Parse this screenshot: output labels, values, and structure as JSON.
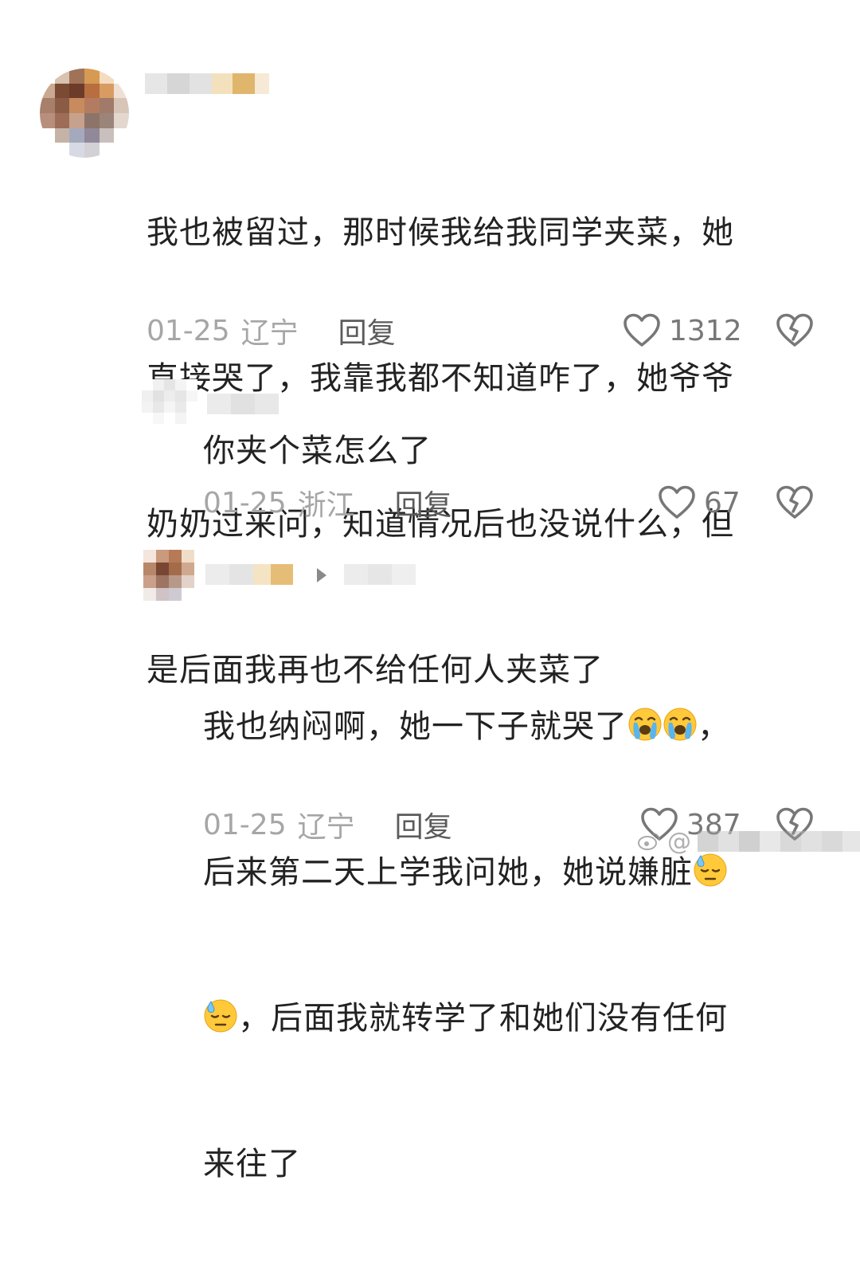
{
  "comments": [
    {
      "text_lines": [
        "我也被留过，那时候我给我同学夹菜，她",
        "直接哭了，我靠我都不知道咋了，她爷爷",
        "奶奶过来问，知道情况后也没说什么，但",
        "是后面我再也不给任何人夹菜了"
      ],
      "date": "01-25",
      "region": "辽宁",
      "reply_label": "回复",
      "likes": "1312"
    },
    {
      "text": "你夹个菜怎么了",
      "date": "01-25",
      "region": "浙江",
      "reply_label": "回复",
      "likes": "67"
    },
    {
      "date": "01-25",
      "region": "辽宁",
      "reply_label": "回复",
      "likes": "387"
    }
  ],
  "reply2_line1_a": "我也纳闷啊，她一下子就哭了",
  "reply2_line1_b": "，",
  "reply2_line2": "后来第二天上学我问她，她说嫌脏",
  "reply2_line3": "，后面我就转学了和她们没有任何",
  "reply2_line4": "来往了",
  "emojis": [
    "loudly-crying-face",
    "loudly-crying-face",
    "downcast-face-with-sweat",
    "downcast-face-with-sweat"
  ],
  "watermark_symbol": "@",
  "colors": {
    "meta_text": "#a6a6a6",
    "reply": "#5b5b5b",
    "body_text": "#222222",
    "icon": "#777777"
  }
}
